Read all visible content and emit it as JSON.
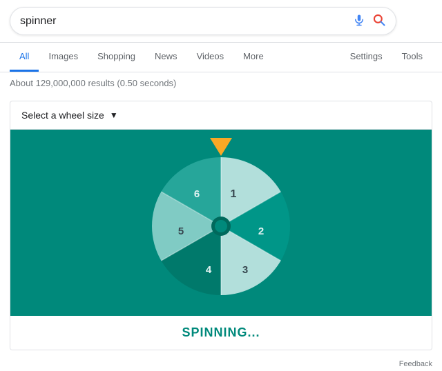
{
  "search": {
    "query": "spinner",
    "mic_label": "mic",
    "search_label": "search"
  },
  "nav": {
    "tabs": [
      {
        "label": "All",
        "active": true
      },
      {
        "label": "Images",
        "active": false
      },
      {
        "label": "Shopping",
        "active": false
      },
      {
        "label": "News",
        "active": false
      },
      {
        "label": "Videos",
        "active": false
      },
      {
        "label": "More",
        "active": false
      }
    ],
    "right_tabs": [
      {
        "label": "Settings"
      },
      {
        "label": "Tools"
      }
    ]
  },
  "results": {
    "info": "About 129,000,000 results (0.50 seconds)"
  },
  "spinner_widget": {
    "wheel_size_label": "Select a wheel size",
    "spinning_text": "SPINNING...",
    "feedback_label": "Feedback",
    "segments": [
      {
        "number": "1",
        "color_light": true
      },
      {
        "number": "2",
        "color_light": false
      },
      {
        "number": "3",
        "color_light": true
      },
      {
        "number": "4",
        "color_light": false
      },
      {
        "number": "5",
        "color_light": true
      },
      {
        "number": "6",
        "color_light": false
      }
    ],
    "colors": {
      "bg": "#00897b",
      "segment_dark": "#00796b",
      "segment_light": "#80cbc4",
      "segment_mid": "#26a69a",
      "center": "#00695c",
      "pointer": "#f9a825",
      "text": "#00897b"
    }
  }
}
